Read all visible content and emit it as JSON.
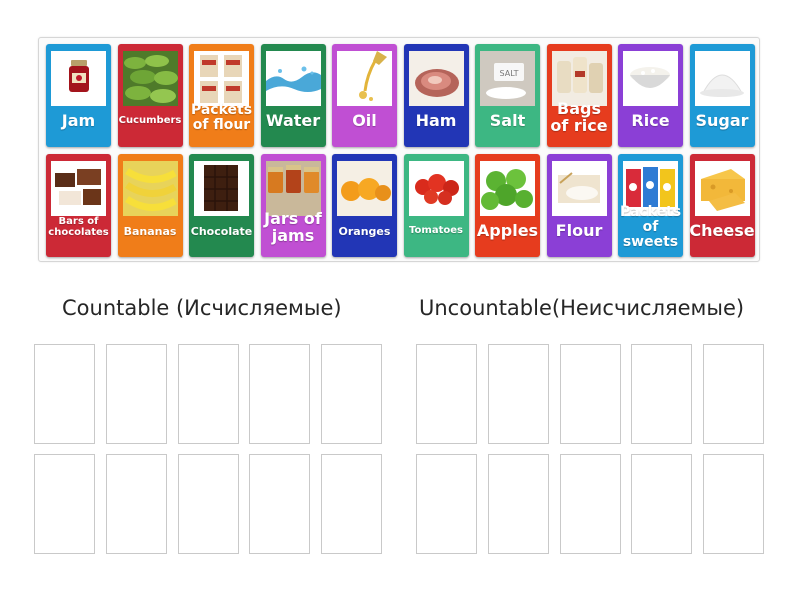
{
  "cards": [
    {
      "label": "Jam",
      "color": "#1e9ad6",
      "icon": "jam-jar-icon",
      "size": "big"
    },
    {
      "label": "Cucumbers",
      "color": "#cc2936",
      "icon": "cucumbers-icon",
      "size": "tiny"
    },
    {
      "label": "Packets of flour",
      "color": "#f07d19",
      "icon": "flour-packets-icon",
      "size": "mid"
    },
    {
      "label": "Water",
      "color": "#23894f",
      "icon": "water-splash-icon",
      "size": "big"
    },
    {
      "label": "Oil",
      "color": "#c04fd3",
      "icon": "oil-pour-icon",
      "size": "big"
    },
    {
      "label": "Ham",
      "color": "#2236b6",
      "icon": "ham-icon",
      "size": "big"
    },
    {
      "label": "Salt",
      "color": "#3db783",
      "icon": "salt-icon",
      "size": "big"
    },
    {
      "label": "Bags of rice",
      "color": "#e63c1e",
      "icon": "rice-bags-icon",
      "size": "big"
    },
    {
      "label": "Rice",
      "color": "#8b3fd6",
      "icon": "rice-bowl-icon",
      "size": "big"
    },
    {
      "label": "Sugar",
      "color": "#1e9ad6",
      "icon": "sugar-icon",
      "size": "big"
    },
    {
      "label": "Bars of chocolates",
      "color": "#cc2936",
      "icon": "chocolate-bars-icon",
      "size": "tiny"
    },
    {
      "label": "Bananas",
      "color": "#f07d19",
      "icon": "bananas-icon",
      "size": "small"
    },
    {
      "label": "Chocolate",
      "color": "#23894f",
      "icon": "chocolate-icon",
      "size": "small"
    },
    {
      "label": "Jars of jams",
      "color": "#c04fd3",
      "icon": "jam-jars-icon",
      "size": "big"
    },
    {
      "label": "Oranges",
      "color": "#2236b6",
      "icon": "oranges-icon",
      "size": "small"
    },
    {
      "label": "Tomatoes",
      "color": "#3db783",
      "icon": "tomatoes-icon",
      "size": "tiny"
    },
    {
      "label": "Apples",
      "color": "#e63c1e",
      "icon": "apples-icon",
      "size": "big"
    },
    {
      "label": "Flour",
      "color": "#8b3fd6",
      "icon": "flour-icon",
      "size": "big"
    },
    {
      "label": "Packets of sweets",
      "color": "#1e9ad6",
      "icon": "sweets-packets-icon",
      "size": "mid"
    },
    {
      "label": "Cheese",
      "color": "#cc2936",
      "icon": "cheese-icon",
      "size": "big"
    }
  ],
  "groups": [
    {
      "title": "Countable (Исчисляемые)",
      "slot_count": 10
    },
    {
      "title": "Uncountable(Неисчисляемые)",
      "slot_count": 10
    }
  ]
}
